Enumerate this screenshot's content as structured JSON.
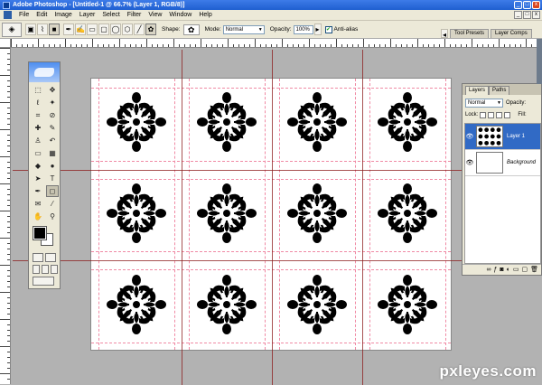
{
  "window": {
    "title": "Adobe Photoshop - [Untitled-1 @ 66.7% (Layer 1, RGB/8)]",
    "controls": [
      "_",
      "□",
      "x"
    ]
  },
  "menu": {
    "items": [
      "File",
      "Edit",
      "Image",
      "Layer",
      "Select",
      "Filter",
      "View",
      "Window",
      "Help"
    ],
    "doc_controls": [
      "_",
      "□",
      "x"
    ]
  },
  "options": {
    "shape_label": "Shape:",
    "mode_label": "Mode:",
    "mode_value": "Normal",
    "opacity_label": "Opacity:",
    "opacity_value": "100%",
    "antialias_label": "Anti-alias",
    "antialias_checked": true,
    "palette_tabs": [
      "Tool Presets",
      "Layer Comps"
    ]
  },
  "canvas": {
    "accent_guide_color": "#8b1a1a",
    "grid_guide_color": "#f08aa4",
    "flower_color": "#000000",
    "rows": 3,
    "columns": 4
  },
  "toolbox": {
    "tools": [
      {
        "icon": "marquee-icon",
        "glyph": "⬚"
      },
      {
        "icon": "move-icon",
        "glyph": "✥"
      },
      {
        "icon": "lasso-icon",
        "glyph": "ℓ"
      },
      {
        "icon": "magic-wand-icon",
        "glyph": "✦"
      },
      {
        "icon": "crop-icon",
        "glyph": "⌗"
      },
      {
        "icon": "slice-icon",
        "glyph": "⊘"
      },
      {
        "icon": "healing-brush-icon",
        "glyph": "✚"
      },
      {
        "icon": "brush-icon",
        "glyph": "✎"
      },
      {
        "icon": "clone-stamp-icon",
        "glyph": "♙"
      },
      {
        "icon": "history-brush-icon",
        "glyph": "↶"
      },
      {
        "icon": "eraser-icon",
        "glyph": "▭"
      },
      {
        "icon": "gradient-icon",
        "glyph": "▦"
      },
      {
        "icon": "blur-icon",
        "glyph": "◆"
      },
      {
        "icon": "dodge-icon",
        "glyph": "●"
      },
      {
        "icon": "path-select-icon",
        "glyph": "➤"
      },
      {
        "icon": "type-icon",
        "glyph": "T"
      },
      {
        "icon": "pen-icon",
        "glyph": "✒"
      },
      {
        "icon": "custom-shape-icon",
        "glyph": "◻"
      },
      {
        "icon": "notes-icon",
        "glyph": "✉"
      },
      {
        "icon": "eyedropper-icon",
        "glyph": "⁄"
      },
      {
        "icon": "hand-icon",
        "glyph": "✋"
      },
      {
        "icon": "zoom-icon",
        "glyph": "⚲"
      }
    ],
    "foreground_color": "#000000",
    "background_color": "#ffffff"
  },
  "layers": {
    "tabs": [
      "Layers",
      "Paths"
    ],
    "blend_mode": "Normal",
    "opacity_label": "Opacity:",
    "lock_label": "Lock:",
    "fill_label": "Fill:",
    "items": [
      {
        "name": "Layer 1",
        "selected": true
      },
      {
        "name": "Background",
        "selected": false
      }
    ],
    "footer_icons": [
      {
        "icon": "link-icon",
        "glyph": "∞"
      },
      {
        "icon": "layer-style-icon",
        "glyph": "ƒ"
      },
      {
        "icon": "mask-icon",
        "glyph": "◙"
      },
      {
        "icon": "adjustment-icon",
        "glyph": "◐"
      },
      {
        "icon": "group-icon",
        "glyph": "▭"
      },
      {
        "icon": "new-layer-icon",
        "glyph": "▢"
      },
      {
        "icon": "delete-icon",
        "glyph": "🗑"
      }
    ]
  },
  "watermark": "pxleyes.com"
}
